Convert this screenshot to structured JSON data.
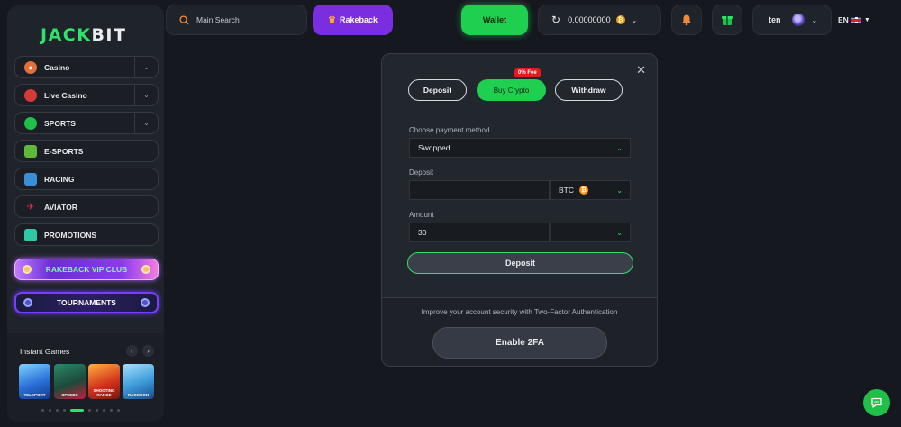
{
  "logo": {
    "part1": "JACK",
    "part2": "BIT"
  },
  "sidebar": {
    "items": [
      {
        "label": "Casino",
        "icon": "casino-icon",
        "expandable": true,
        "color": "#e0703a"
      },
      {
        "label": "Live Casino",
        "icon": "live-casino-icon",
        "expandable": true,
        "color": "#d43a3a"
      },
      {
        "label": "SPORTS",
        "icon": "sports-icon",
        "expandable": true,
        "color": "#1fbf4a"
      },
      {
        "label": "E-SPORTS",
        "icon": "esports-icon",
        "expandable": false,
        "color": "#5fb83a"
      },
      {
        "label": "RACING",
        "icon": "racing-icon",
        "expandable": false,
        "color": "#3a8fd4"
      },
      {
        "label": "AVIATOR",
        "icon": "aviator-icon",
        "expandable": false,
        "color": "#d42a4a"
      },
      {
        "label": "PROMOTIONS",
        "icon": "promotions-icon",
        "expandable": false,
        "color": "#2fc9a6"
      }
    ],
    "vip_label": "RAKEBACK VIP CLUB",
    "tournaments_label": "TOURNAMENTS",
    "instant_games": {
      "title": "Instant Games",
      "games": [
        {
          "name": "TELEPORT",
          "color": "#2aa6e8"
        },
        {
          "name": "SPEEDX",
          "color": "#1e8f6a"
        },
        {
          "name": "SHOOTING RANGE",
          "color": "#d4361e"
        },
        {
          "name": "RACCOON",
          "color": "#3c9bd8"
        }
      ]
    }
  },
  "topbar": {
    "search_label": "Main Search",
    "rakeback_label": "Rakeback",
    "wallet_label": "Wallet",
    "balance": "0.00000000",
    "username": "ten",
    "language": "EN"
  },
  "modal": {
    "tabs": {
      "deposit": "Deposit",
      "buy_crypto": "Buy Crypto",
      "withdraw": "Withdraw"
    },
    "fee_badge": "0% Fee",
    "payment_label": "Choose payment method",
    "payment_value": "Swopped",
    "deposit_label": "Deposit",
    "deposit_value": "",
    "currency": "BTC",
    "amount_label": "Amount",
    "amount_value": "30",
    "amount_currency": "",
    "deposit_button": "Deposit",
    "tfa_text": "Improve your account security with Two-Factor Authentication",
    "tfa_button": "Enable 2FA"
  },
  "colors": {
    "accent": "#1fcf4f",
    "rakeback": "#7a2ee0",
    "background": "#15181e"
  }
}
